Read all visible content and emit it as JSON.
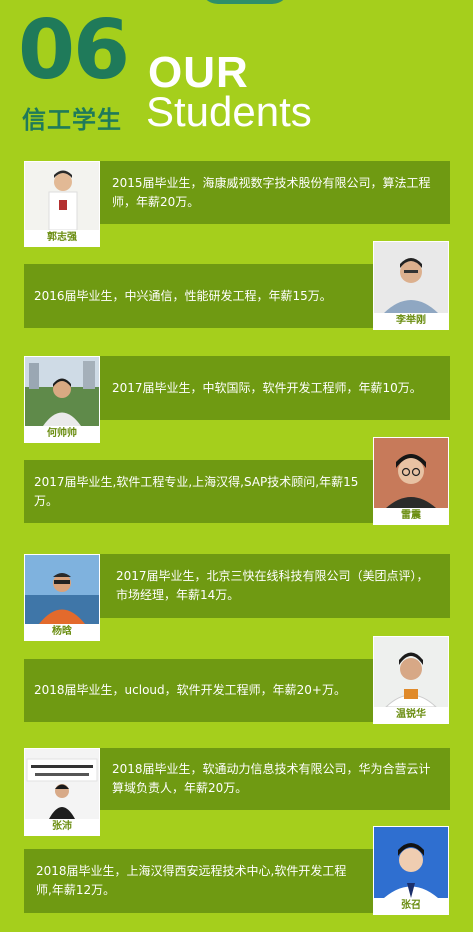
{
  "header": {
    "number": "06",
    "cn_title": "信工学生",
    "en_line1": "OUR",
    "en_line2": "Students"
  },
  "students": [
    {
      "name": "郭志强",
      "text": "2015届毕业生，海康威视数字技术股份有限公司，算法工程师，年薪20万。"
    },
    {
      "name": "李举刚",
      "text": "2016届毕业生，中兴通信，性能研发工程，年薪15万。"
    },
    {
      "name": "何帅帅",
      "text": "2017届毕业生，中软国际，软件开发工程师，年薪10万。"
    },
    {
      "name": "雷震",
      "text": "2017届毕业生,软件工程专业,上海汉得,SAP技术顾问,年薪15万。"
    },
    {
      "name": "杨晗",
      "text": "2017届毕业生，北京三快在线科技有限公司（美团点评），市场经理，年薪14万。"
    },
    {
      "name": "温锐华",
      "text": "2018届毕业生，ucloud，软件开发工程师，年薪20+万。"
    },
    {
      "name": "张沛",
      "text": "2018届毕业生，软通动力信息技术有限公司，华为合营云计算域负责人，年薪20万。"
    },
    {
      "name": "张召",
      "text": "2018届毕业生，上海汉得西安远程技术中心,软件开发工程师,年薪12万。"
    }
  ]
}
